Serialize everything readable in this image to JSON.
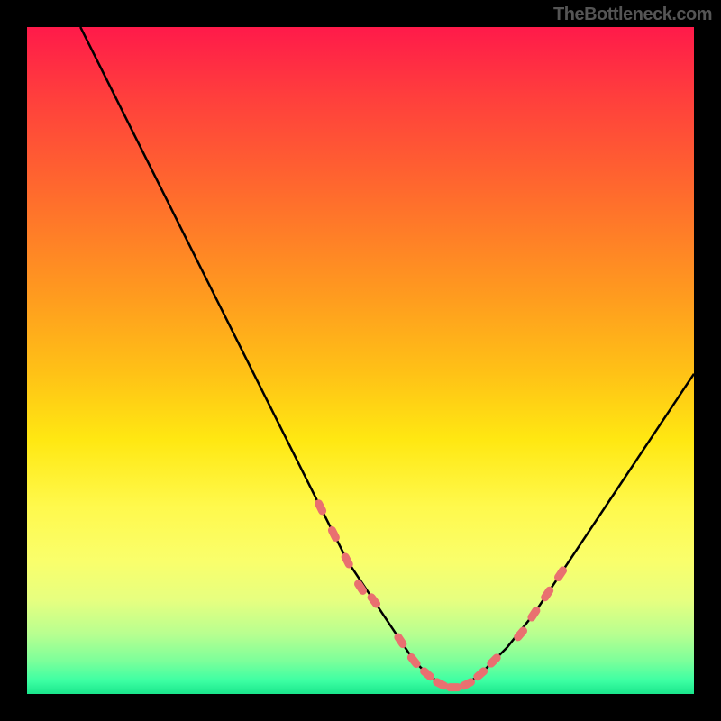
{
  "watermark": "TheBottleneck.com",
  "chart_data": {
    "type": "line",
    "title": "",
    "xlabel": "",
    "ylabel": "",
    "xlim": [
      0,
      100
    ],
    "ylim": [
      0,
      100
    ],
    "curve": {
      "name": "bottleneck-curve",
      "color": "#000000",
      "x": [
        8,
        12,
        16,
        20,
        24,
        28,
        32,
        36,
        40,
        44,
        48,
        52,
        56,
        58,
        60,
        62,
        64,
        66,
        68,
        72,
        76,
        80,
        84,
        88,
        92,
        96,
        100
      ],
      "y": [
        100,
        92,
        84,
        76,
        68,
        60,
        52,
        44,
        36,
        28,
        20,
        14,
        8,
        5,
        3,
        1.5,
        1,
        1.5,
        3,
        7,
        12,
        18,
        24,
        30,
        36,
        42,
        48
      ]
    },
    "markers": {
      "name": "highlight-points",
      "color": "#e97070",
      "x": [
        44,
        46,
        48,
        50,
        52,
        56,
        58,
        60,
        62,
        64,
        66,
        68,
        70,
        74,
        76,
        78,
        80
      ],
      "y": [
        28,
        24,
        20,
        16,
        14,
        8,
        5,
        3,
        1.5,
        1,
        1.5,
        3,
        5,
        9,
        12,
        15,
        18
      ]
    },
    "gradient_stops": [
      {
        "pos": 0,
        "color": "#ff1a4a"
      },
      {
        "pos": 10,
        "color": "#ff3d3d"
      },
      {
        "pos": 25,
        "color": "#ff6b2d"
      },
      {
        "pos": 40,
        "color": "#ff9a1f"
      },
      {
        "pos": 52,
        "color": "#ffc216"
      },
      {
        "pos": 62,
        "color": "#ffe812"
      },
      {
        "pos": 72,
        "color": "#fff94d"
      },
      {
        "pos": 80,
        "color": "#faff6b"
      },
      {
        "pos": 86,
        "color": "#e6ff80"
      },
      {
        "pos": 91,
        "color": "#b8ff90"
      },
      {
        "pos": 95,
        "color": "#7dff9a"
      },
      {
        "pos": 98,
        "color": "#3dffa3"
      },
      {
        "pos": 100,
        "color": "#1ae68c"
      }
    ]
  }
}
